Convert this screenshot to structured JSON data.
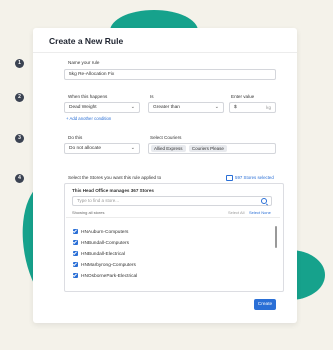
{
  "dialog": {
    "title": "Create a New Rule"
  },
  "steps": [
    "1",
    "2",
    "3",
    "4"
  ],
  "rule_name": {
    "label": "Name your rule",
    "value": "5kg Re-Allocation Fix"
  },
  "when": {
    "label": "When this happens",
    "value": "Dead Weight",
    "is_label": "Is",
    "is_value": "Greater than",
    "enter_label": "Enter value",
    "enter_value": "$",
    "unit": "kg",
    "add_condition": "+ Add another condition"
  },
  "action": {
    "do_label": "Do this",
    "do_value": "Do not allocate",
    "couriers_label": "Select Couriers",
    "couriers": [
      "Allied Express",
      "Couriers Please"
    ]
  },
  "stores": {
    "label": "Select the Stores you want this rule applied to",
    "selected_count": "597 Stores selected",
    "manages_text": "This Head Office manages 367 Stores",
    "search_placeholder": "Type to find a store...",
    "showing": "Showing all stores",
    "select_all": "Select All",
    "select_none": "Select None",
    "items": [
      "HNAuburn-Computers",
      "HNBundall-Computers",
      "HNBundall-Electrical",
      "HNMarbyrong-Computers",
      "HNOsbornePark-Electrical"
    ]
  },
  "buttons": {
    "create": "Create"
  },
  "colors": {
    "accent": "#2a6fd6",
    "teal": "#16a28c",
    "bg": "#f4f2ea"
  }
}
